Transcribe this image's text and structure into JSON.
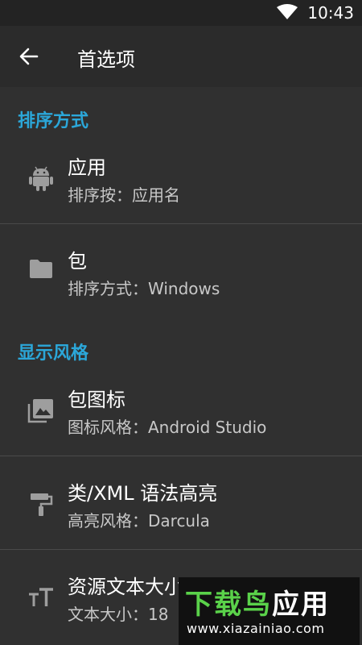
{
  "status_bar": {
    "time": "10:43"
  },
  "toolbar": {
    "title": "首选项"
  },
  "sections": [
    {
      "header": "排序方式"
    },
    {
      "header": "显示风格"
    }
  ],
  "items": [
    {
      "title": "应用",
      "summary": "排序按：应用名",
      "icon": "android-icon"
    },
    {
      "title": "包",
      "summary": "排序方式：Windows",
      "icon": "folder-icon"
    },
    {
      "title": "包图标",
      "summary": "图标风格：Android Studio",
      "icon": "image-stack-icon"
    },
    {
      "title": "类/XML 语法高亮",
      "summary": "高亮风格：Darcula",
      "icon": "paint-roller-icon"
    },
    {
      "title": "资源文本大小",
      "summary": "文本大小：18",
      "icon": "text-size-icon"
    }
  ],
  "watermark": {
    "brand_green": "下载鸟",
    "brand_white": "应用",
    "url": "www.xiazainiao.com"
  },
  "colors": {
    "accent": "#2ba7d9",
    "background": "#303030",
    "toolbar": "#2b2b2b"
  }
}
